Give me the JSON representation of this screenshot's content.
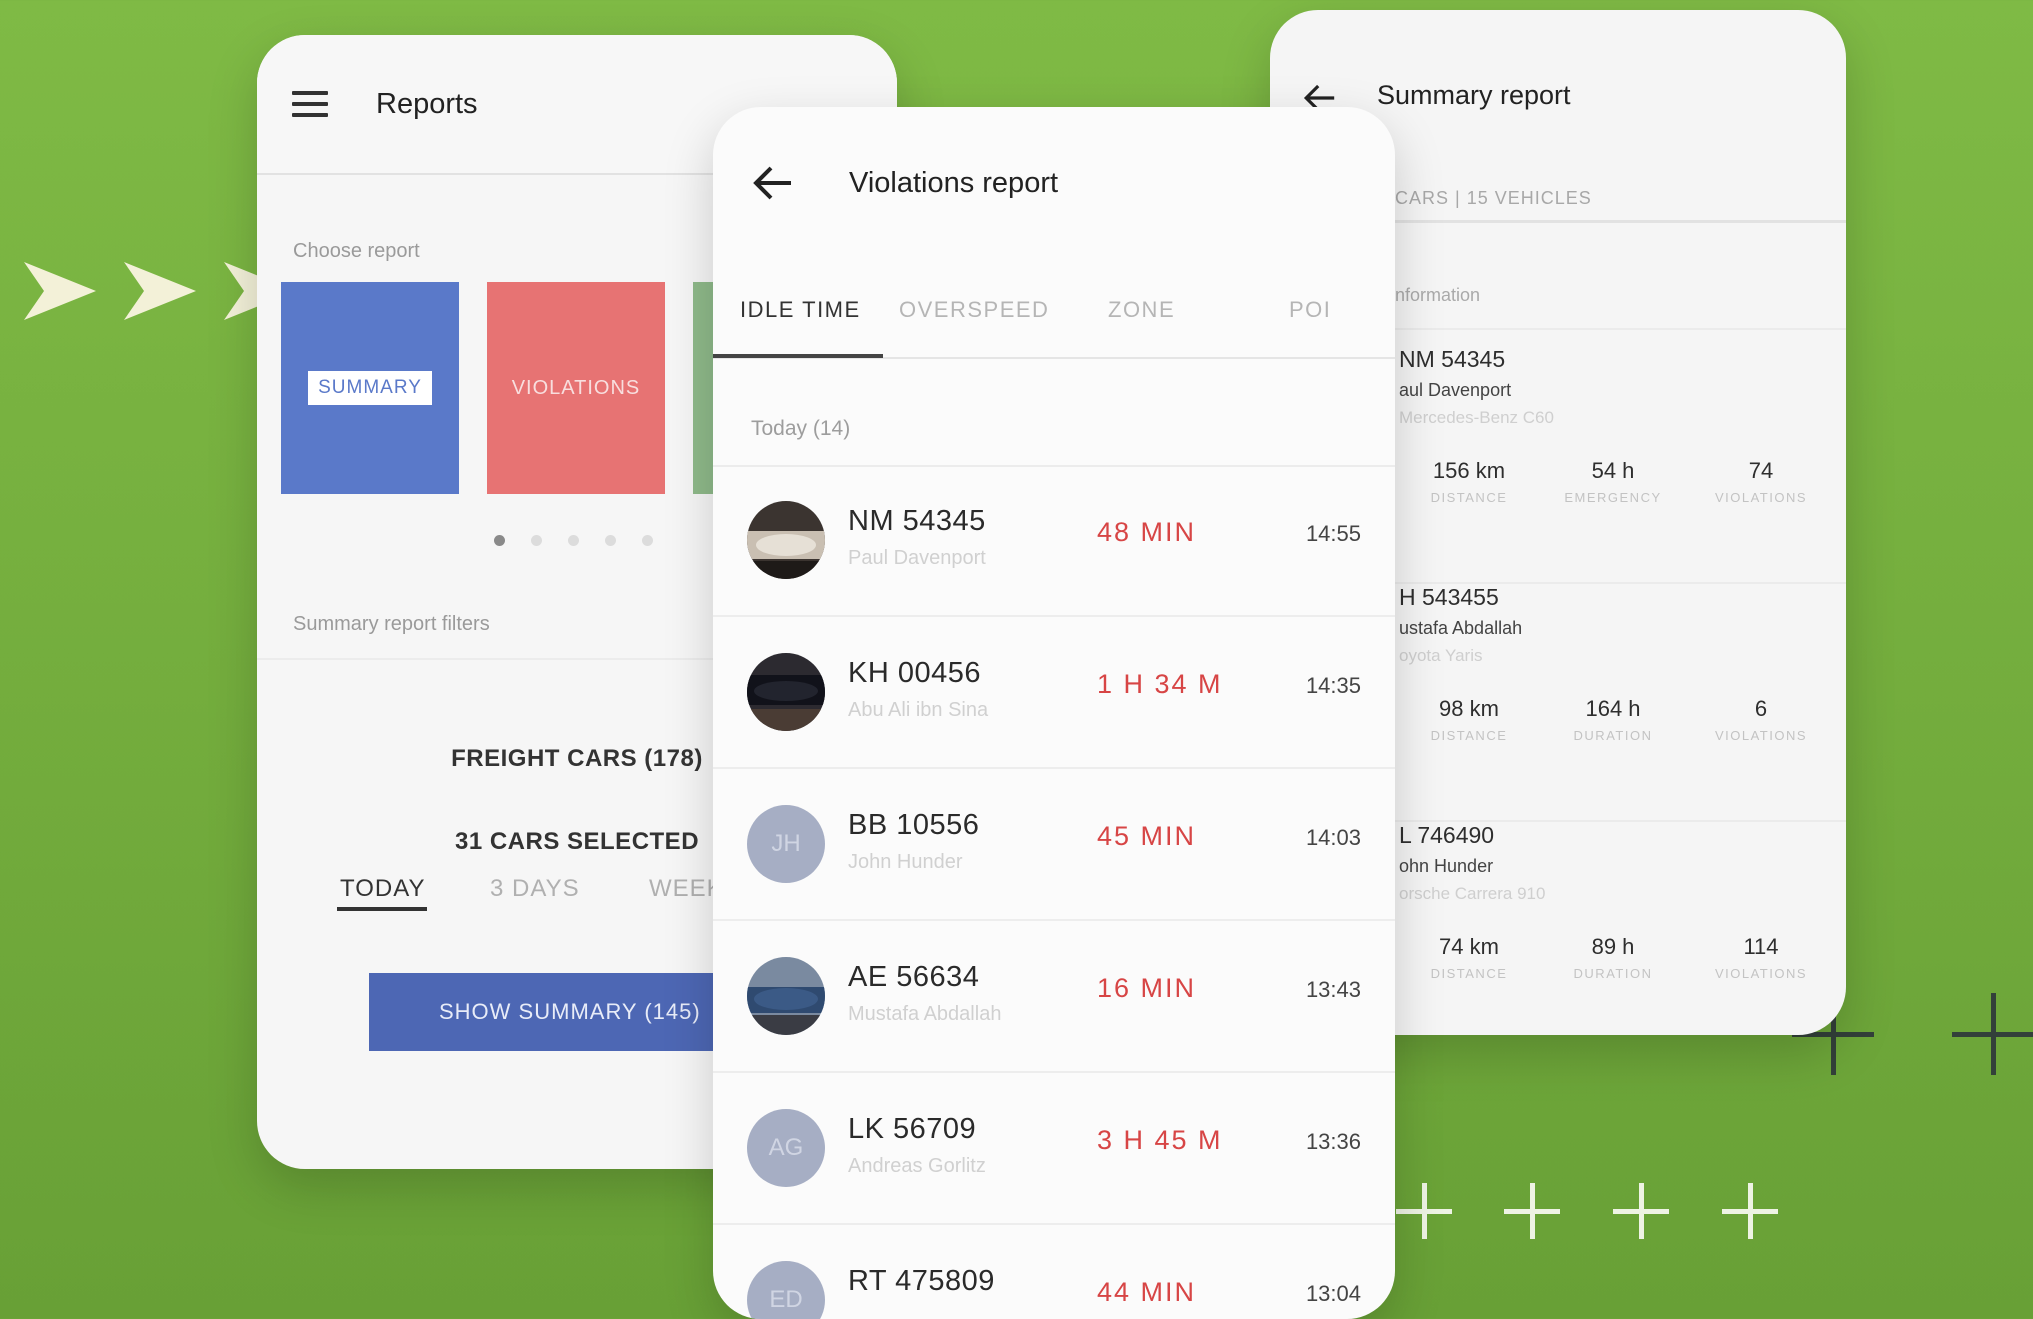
{
  "reports": {
    "title": "Reports",
    "choose_label": "Choose report",
    "tiles": [
      {
        "label": "SUMMARY",
        "color": "#5a79c9"
      },
      {
        "label": "VIOLATIONS",
        "color": "#e77373"
      }
    ],
    "filters_label": "Summary report filters",
    "group_filter": "FREIGHT CARS (178)",
    "selection": "31 CARS SELECTED",
    "periods": [
      "TODAY",
      "3 DAYS",
      "WEEK"
    ],
    "show_button": "SHOW SUMMARY (145)"
  },
  "violations": {
    "title": "Violations report",
    "tabs": [
      "IDLE TIME",
      "OVERSPEED",
      "ZONE",
      "POI"
    ],
    "list_header": "Today (14)",
    "rows": [
      {
        "plate": "NM 54345",
        "driver": "Paul Davenport",
        "duration": "48 MIN",
        "time": "14:55",
        "avatar": "car-photo-silver"
      },
      {
        "plate": "KH 00456",
        "driver": "Abu Ali ibn Sina",
        "duration": "1 H 34 M",
        "time": "14:35",
        "avatar": "car-photo-black"
      },
      {
        "plate": "BB 10556",
        "driver": "John Hunder",
        "duration": "45 MIN",
        "time": "14:03",
        "avatar": "JH"
      },
      {
        "plate": "AE 56634",
        "driver": "Mustafa Abdallah",
        "duration": "16 MIN",
        "time": "13:43",
        "avatar": "car-photo-blue"
      },
      {
        "plate": "LK 56709",
        "driver": "Andreas Gorlitz",
        "duration": "3 H 45 M",
        "time": "13:36",
        "avatar": "AG"
      },
      {
        "plate": "RT 475809",
        "driver": "",
        "duration": "44 MIN",
        "time": "13:04",
        "avatar": "ED"
      }
    ]
  },
  "summary": {
    "title": "Summary report",
    "subtitle": "CARS | 15 VEHICLES",
    "section": "nformation",
    "entries": [
      {
        "plate": "NM 54345",
        "driver": "aul Davenport",
        "car": "Mercedes-Benz C60",
        "stats": [
          {
            "value": "156 km",
            "label": "DISTANCE"
          },
          {
            "value": "54 h",
            "label": "EMERGENCY"
          },
          {
            "value": "74",
            "label": "VIOLATIONS"
          }
        ]
      },
      {
        "plate": "H 543455",
        "driver": "ustafa Abdallah",
        "car": "oyota Yaris",
        "stats": [
          {
            "value": "98 km",
            "label": "DISTANCE"
          },
          {
            "value": "164 h",
            "label": "DURATION"
          },
          {
            "value": "6",
            "label": "VIOLATIONS"
          }
        ]
      },
      {
        "plate": "L 746490",
        "driver": "ohn Hunder",
        "car": "orsche Carrera 910",
        "stats": [
          {
            "value": "74 km",
            "label": "DISTANCE"
          },
          {
            "value": "89 h",
            "label": "DURATION"
          },
          {
            "value": "114",
            "label": "VIOLATIONS"
          }
        ]
      }
    ]
  },
  "colors": {
    "background": "#7fba45",
    "primary_button": "#4d67b4",
    "duration_red": "#d74545"
  }
}
